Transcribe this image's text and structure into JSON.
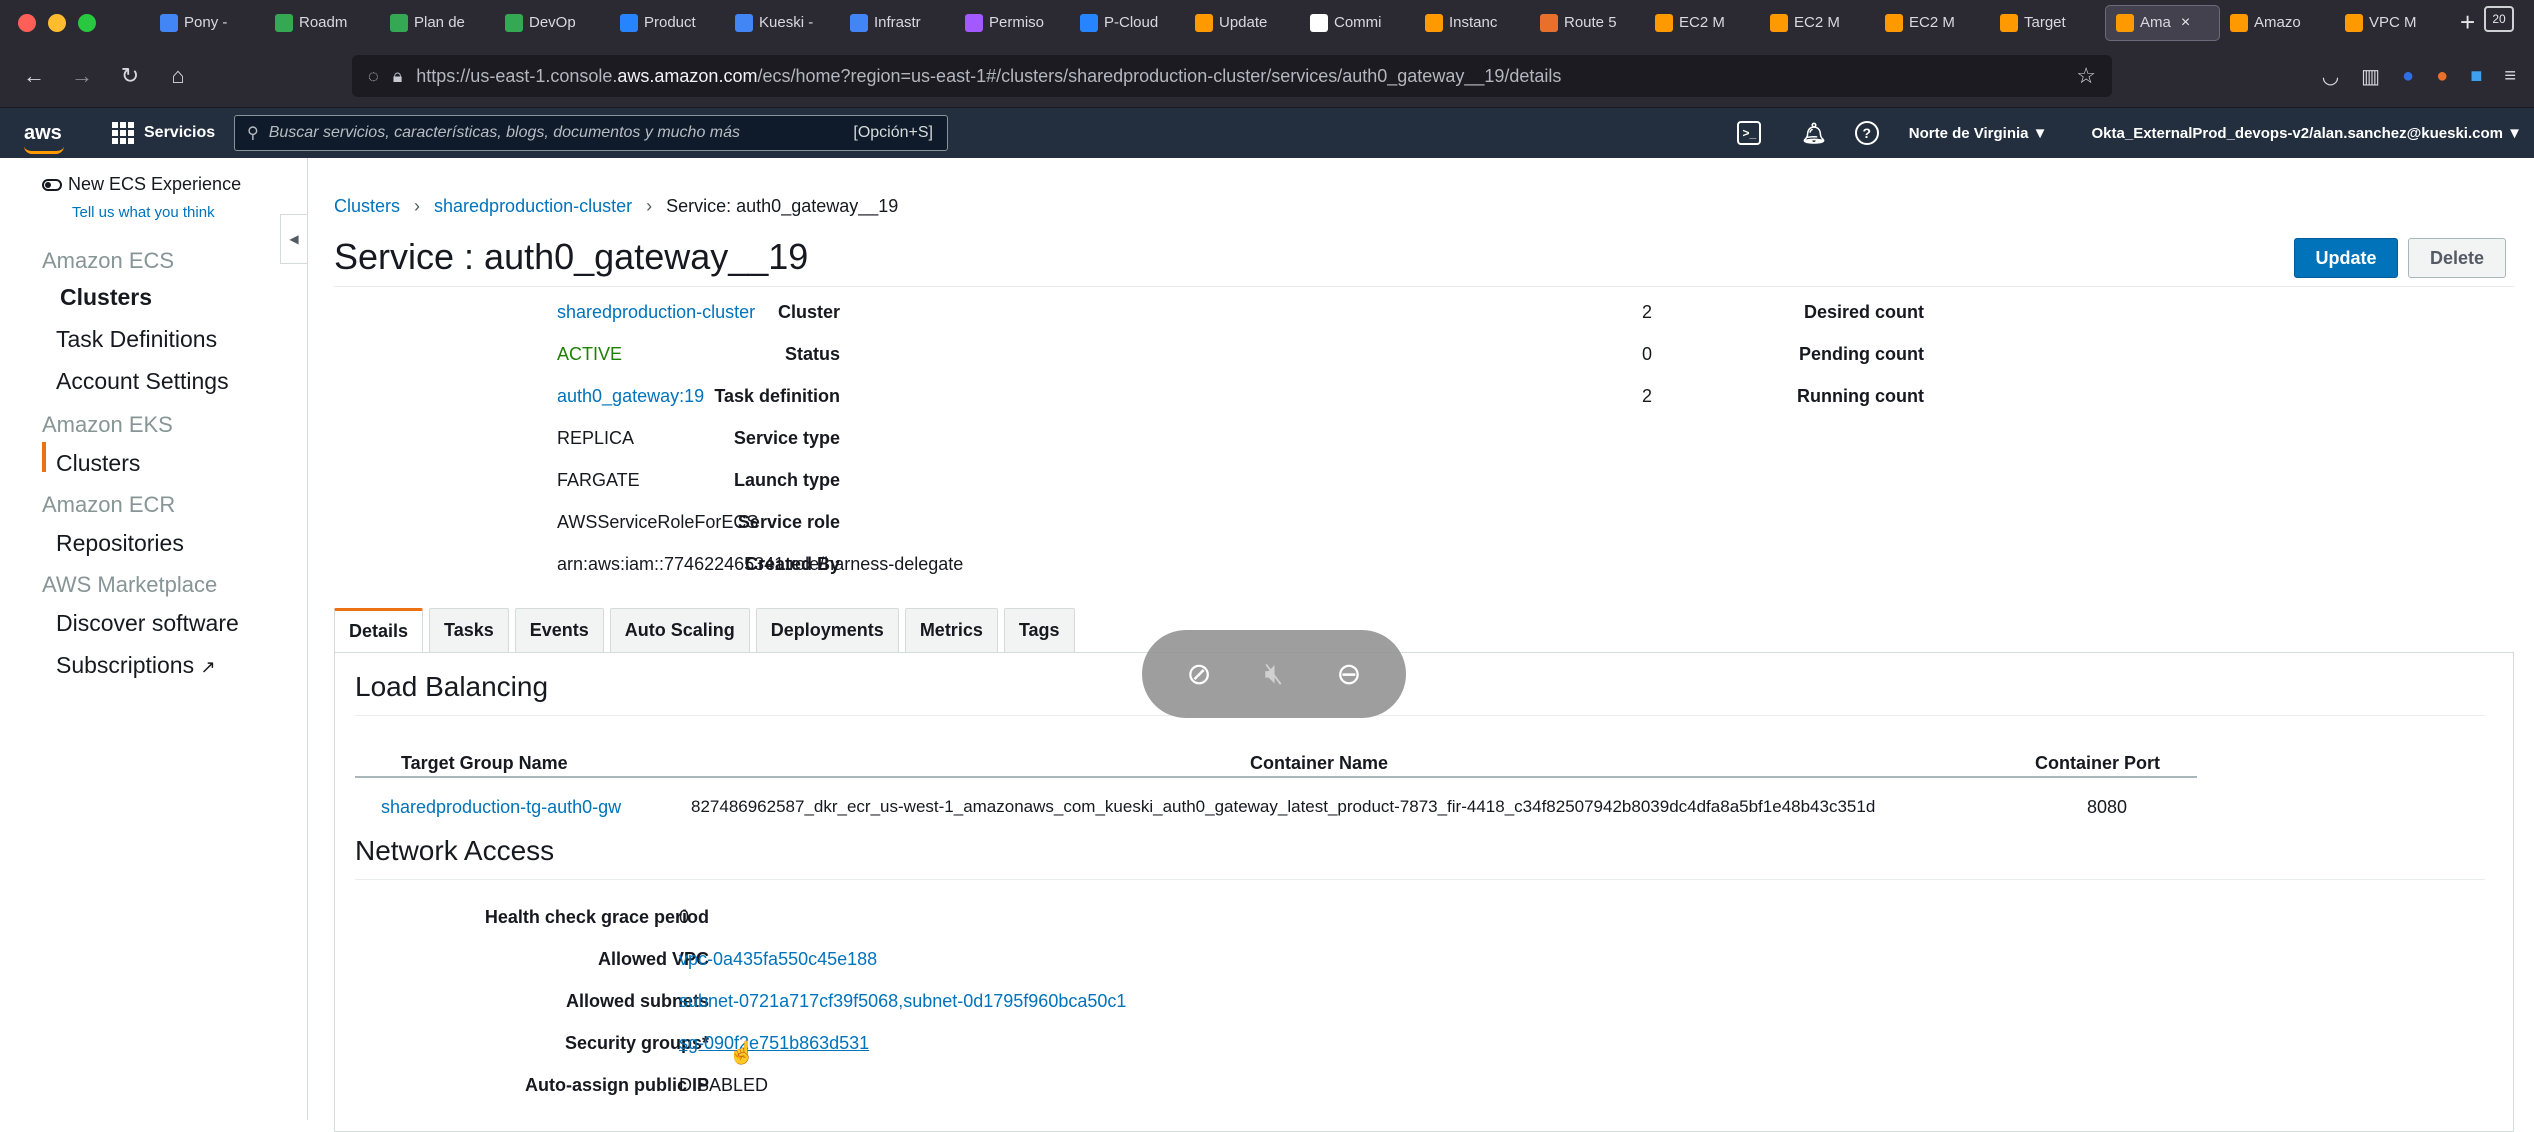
{
  "browser": {
    "tabs": [
      {
        "title": "Pony -",
        "color": "#4285f4"
      },
      {
        "title": "Roadm",
        "color": "#34a853"
      },
      {
        "title": "Plan de",
        "color": "#34a853"
      },
      {
        "title": "DevOp",
        "color": "#34a853"
      },
      {
        "title": "Product",
        "color": "#2684ff"
      },
      {
        "title": "Kueski -",
        "color": "#4285f4"
      },
      {
        "title": "Infrastr",
        "color": "#4285f4"
      },
      {
        "title": "Permiso",
        "color": "#a259ff"
      },
      {
        "title": "P-Cloud",
        "color": "#2684ff"
      },
      {
        "title": "Update",
        "color": "#ff9900"
      },
      {
        "title": "Commi",
        "color": "#ffffff"
      },
      {
        "title": "Instanc",
        "color": "#ff9900"
      },
      {
        "title": "Route 5",
        "color": "#e8702a"
      },
      {
        "title": "EC2 M",
        "color": "#ff9900"
      },
      {
        "title": "EC2 M",
        "color": "#ff9900"
      },
      {
        "title": "EC2 M",
        "color": "#ff9900"
      },
      {
        "title": "Target",
        "color": "#ff9900"
      },
      {
        "title": "Ama",
        "color": "#ff9900",
        "active": true
      },
      {
        "title": "Amazo",
        "color": "#ff9900"
      },
      {
        "title": "VPC M",
        "color": "#ff9900"
      }
    ],
    "tab_count": "20",
    "url_prefix": "https://us-east-1.console.",
    "url_domain": "aws.amazon.com",
    "url_suffix": "/ecs/home?region=us-east-1#/clusters/sharedproduction-cluster/services/auth0_gateway__19/details"
  },
  "aws_header": {
    "logo": "aws",
    "services_label": "Servicios",
    "search_placeholder": "Buscar servicios, características, blogs, documentos y mucho más",
    "search_shortcut": "[Opción+S]",
    "region": "Norte de Virginia ▼",
    "user": "Okta_ExternalProd_devops-v2/alan.sanchez@kueski.com ▼"
  },
  "sidebar": {
    "new_experience": "New ECS Experience",
    "tell_us": "Tell us what you think",
    "groups": [
      {
        "title": "Amazon ECS",
        "items": [
          "Clusters",
          "Task Definitions",
          "Account Settings"
        ]
      },
      {
        "title": "Amazon EKS",
        "items": [
          "Clusters"
        ]
      },
      {
        "title": "Amazon ECR",
        "items": [
          "Repositories"
        ]
      },
      {
        "title": "AWS Marketplace",
        "items": [
          "Discover software",
          "Subscriptions"
        ]
      }
    ],
    "active_item": "Clusters"
  },
  "breadcrumb": {
    "root": "Clusters",
    "cluster": "sharedproduction-cluster",
    "current": "Service: auth0_gateway__19"
  },
  "page": {
    "title": "Service : auth0_gateway__19",
    "update_label": "Update",
    "delete_label": "Delete"
  },
  "details": {
    "cluster_label": "Cluster",
    "cluster": "sharedproduction-cluster",
    "status_label": "Status",
    "status": "ACTIVE",
    "taskdef_label": "Task definition",
    "taskdef": "auth0_gateway:19",
    "servicetype_label": "Service type",
    "servicetype": "REPLICA",
    "launchtype_label": "Launch type",
    "launchtype": "FARGATE",
    "servicerole_label": "Service role",
    "servicerole": "AWSServiceRoleForECS",
    "createdby_label": "Created By",
    "createdby": "arn:aws:iam::774622465341:role/harness-delegate",
    "desired_label": "Desired count",
    "desired": "2",
    "pending_label": "Pending count",
    "pending": "0",
    "running_label": "Running count",
    "running": "2"
  },
  "tabs": [
    "Details",
    "Tasks",
    "Events",
    "Auto Scaling",
    "Deployments",
    "Metrics",
    "Tags"
  ],
  "load_balancing": {
    "title": "Load Balancing",
    "columns": [
      "Target Group Name",
      "Container Name",
      "Container Port"
    ],
    "row": {
      "target_group": "sharedproduction-tg-auth0-gw",
      "container_name": "827486962587_dkr_ecr_us-west-1_amazonaws_com_kueski_auth0_gateway_latest_product-7873_fir-4418_c34f82507942b8039dc4dfa8a5bf1e48b43c351d",
      "container_port": "8080"
    }
  },
  "network_access": {
    "title": "Network Access",
    "grace_label": "Health check grace period",
    "grace": "0",
    "vpc_label": "Allowed VPC",
    "vpc": "vpc-0a435fa550c45e188",
    "subnets_label": "Allowed subnets",
    "subnets": "subnet-0721a717cf39f5068,subnet-0d1795f960bca50c1",
    "sg_label": "Security groups*",
    "sg": "sg-090f2e751b863d531",
    "publicip_label": "Auto-assign public IP",
    "publicip": "DISABLED"
  }
}
